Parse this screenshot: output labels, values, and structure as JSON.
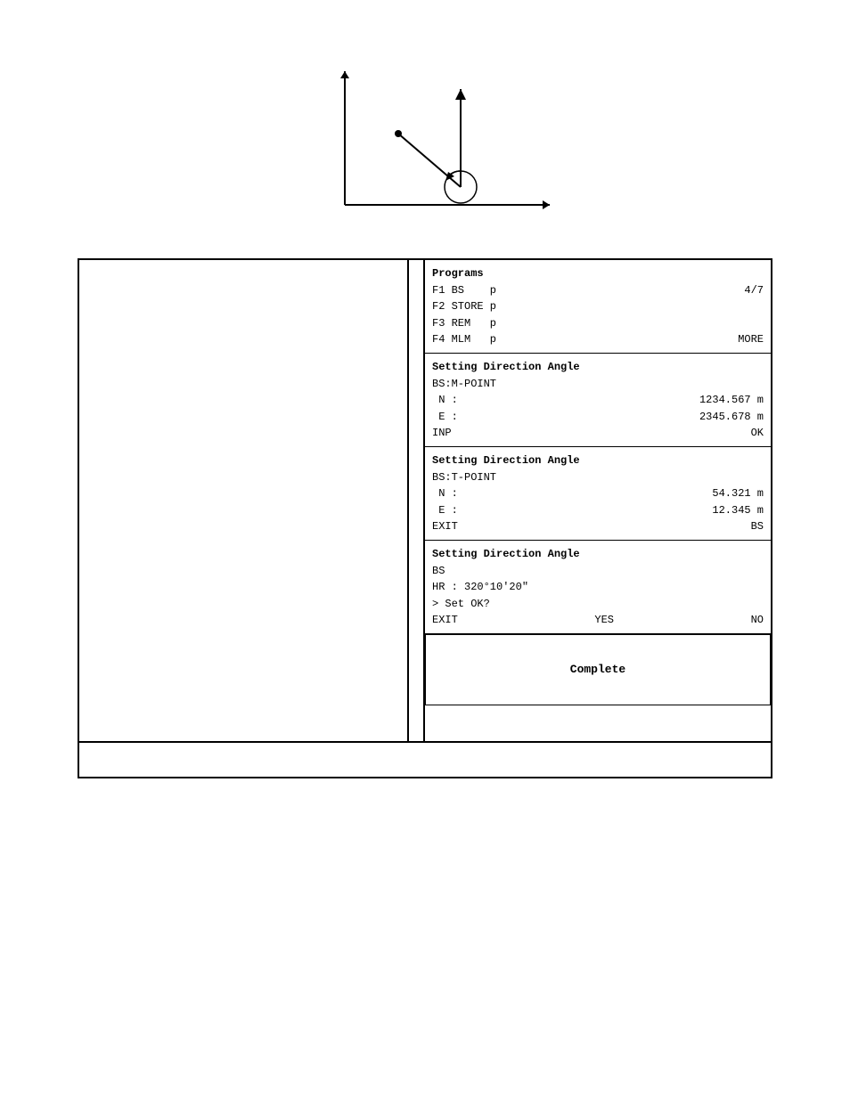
{
  "diagram": {
    "aria_label": "Direction angle setting diagram with coordinate axes, north arrow, and angle indicator"
  },
  "screens": {
    "screen1": {
      "title": "Programs",
      "line1_left": "F1 BS",
      "line1_mid": "p",
      "line1_right": "4/7",
      "line2_left": "F2 STORE",
      "line2_mid": "p",
      "line3_left": "F3 REM",
      "line3_mid": "p",
      "line4_left": "F4 MLM",
      "line4_mid": "p",
      "line4_right": "MORE"
    },
    "screen2": {
      "title": "Setting Direction Angle",
      "subtitle": "BS:M-POINT",
      "n_label": "N :",
      "n_value": "1234.567 m",
      "e_label": "E :",
      "e_value": "2345.678 m",
      "btn_left": "INP",
      "btn_right": "OK"
    },
    "screen3": {
      "title": "Setting Direction Angle",
      "subtitle": "BS:T-POINT",
      "n_label": "N :",
      "n_value": "54.321 m",
      "e_label": "E :",
      "e_value": "12.345 m",
      "btn_left": "EXIT",
      "btn_right": "BS"
    },
    "screen4": {
      "title": "Setting Direction Angle",
      "subtitle": "BS",
      "hr_label": "HR : 320°10'20\"",
      "prompt": "> Set OK?",
      "btn_left": "EXIT",
      "btn_mid": "YES",
      "btn_right": "NO"
    },
    "screen5": {
      "complete_text": "Complete"
    }
  },
  "footer": {
    "text": ""
  }
}
